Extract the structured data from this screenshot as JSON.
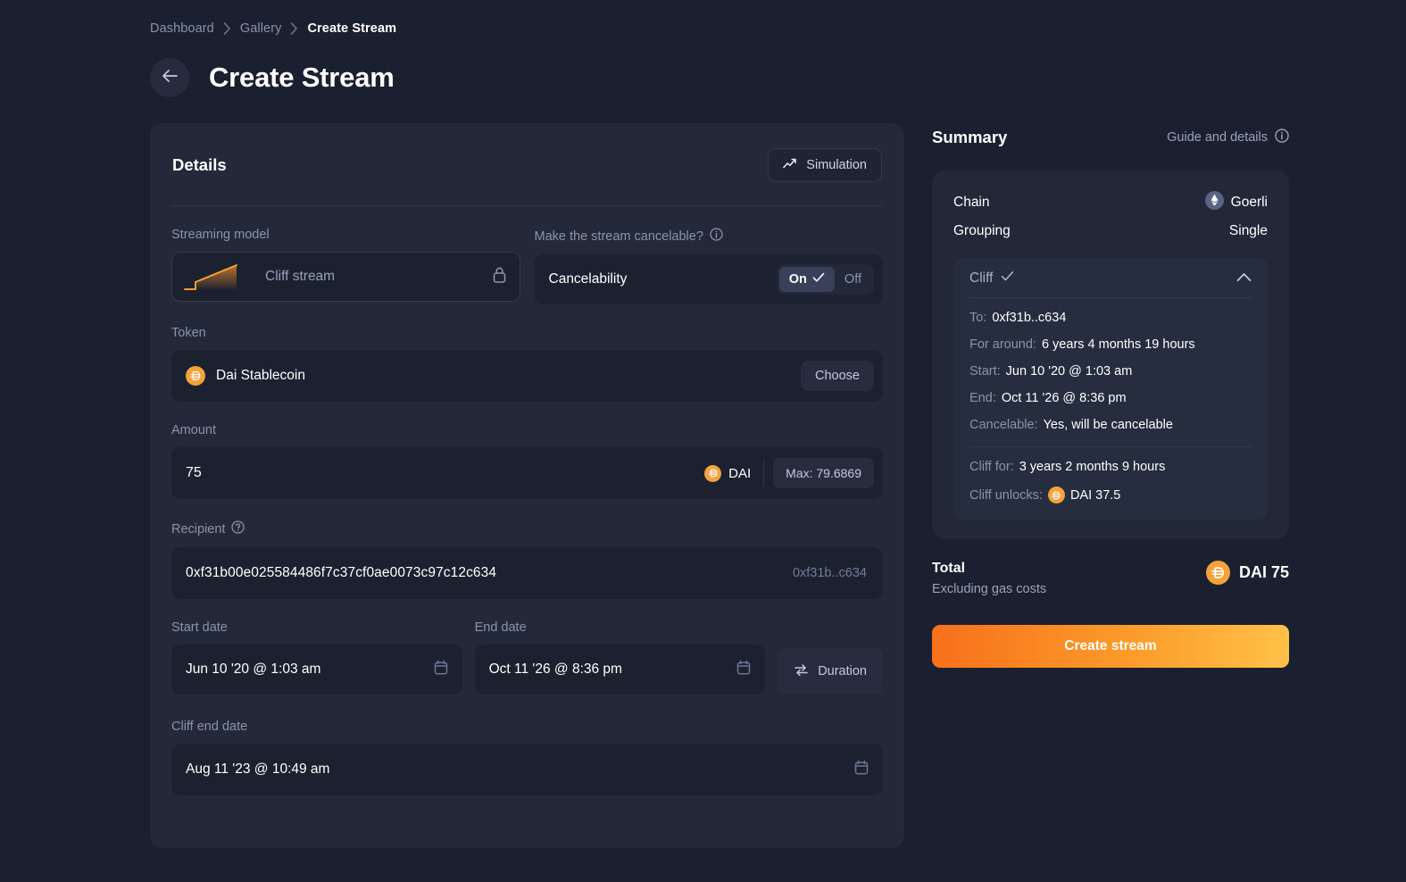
{
  "breadcrumb": [
    {
      "label": "Dashboard",
      "active": false
    },
    {
      "label": "Gallery",
      "active": false
    },
    {
      "label": "Create Stream",
      "active": true
    }
  ],
  "header": {
    "title": "Create Stream",
    "back_icon": "arrow-left-icon"
  },
  "details": {
    "title": "Details",
    "simulation_label": "Simulation",
    "streaming_model": {
      "label": "Streaming model",
      "value": "Cliff stream",
      "locked": true
    },
    "cancelable": {
      "label": "Make the stream cancelable?",
      "row_label": "Cancelability",
      "options": [
        "On",
        "Off"
      ],
      "selected": "On"
    },
    "token": {
      "label": "Token",
      "value": "Dai Stablecoin",
      "choose_label": "Choose"
    },
    "amount": {
      "label": "Amount",
      "value": "75",
      "symbol": "DAI",
      "max_label": "Max: 79.6869"
    },
    "recipient": {
      "label": "Recipient",
      "value": "0xf31b00e025584486f7c37cf0ae0073c97c12c634",
      "short": "0xf31b..c634"
    },
    "start_date": {
      "label": "Start date",
      "value": "Jun 10 '20 @ 1:03 am"
    },
    "end_date": {
      "label": "End date",
      "value": "Oct 11 '26 @ 8:36 pm"
    },
    "duration_label": "Duration",
    "cliff_end_date": {
      "label": "Cliff end date",
      "value": "Aug 11 '23 @ 10:49 am"
    }
  },
  "summary": {
    "title": "Summary",
    "guide_label": "Guide and details",
    "chain": {
      "key": "Chain",
      "value": "Goerli"
    },
    "grouping": {
      "key": "Grouping",
      "value": "Single"
    },
    "cliff": {
      "title": "Cliff",
      "to": {
        "key": "To:",
        "value": "0xf31b..c634"
      },
      "for_around": {
        "key": "For around:",
        "value": "6 years 4 months 19 hours"
      },
      "start": {
        "key": "Start:",
        "value": "Jun 10 '20 @ 1:03 am"
      },
      "end": {
        "key": "End:",
        "value": "Oct 11 '26 @ 8:36 pm"
      },
      "cancelable": {
        "key": "Cancelable:",
        "value": "Yes, will be cancelable"
      },
      "cliff_for": {
        "key": "Cliff for:",
        "value": "3 years 2 months 9 hours"
      },
      "cliff_unlocks": {
        "key": "Cliff unlocks:",
        "value": "DAI 37.5"
      }
    },
    "total": {
      "title": "Total",
      "subtitle": "Excluding gas costs",
      "value": "DAI 75"
    },
    "create_label": "Create stream"
  },
  "colors": {
    "page_bg": "#1b2030",
    "card_bg": "#232939",
    "input_bg": "#1c2130",
    "accent_orange": "#f8701b",
    "accent_amber": "#ffc148",
    "dai_orange": "#f5a23c",
    "text_muted": "#8a93ab"
  }
}
